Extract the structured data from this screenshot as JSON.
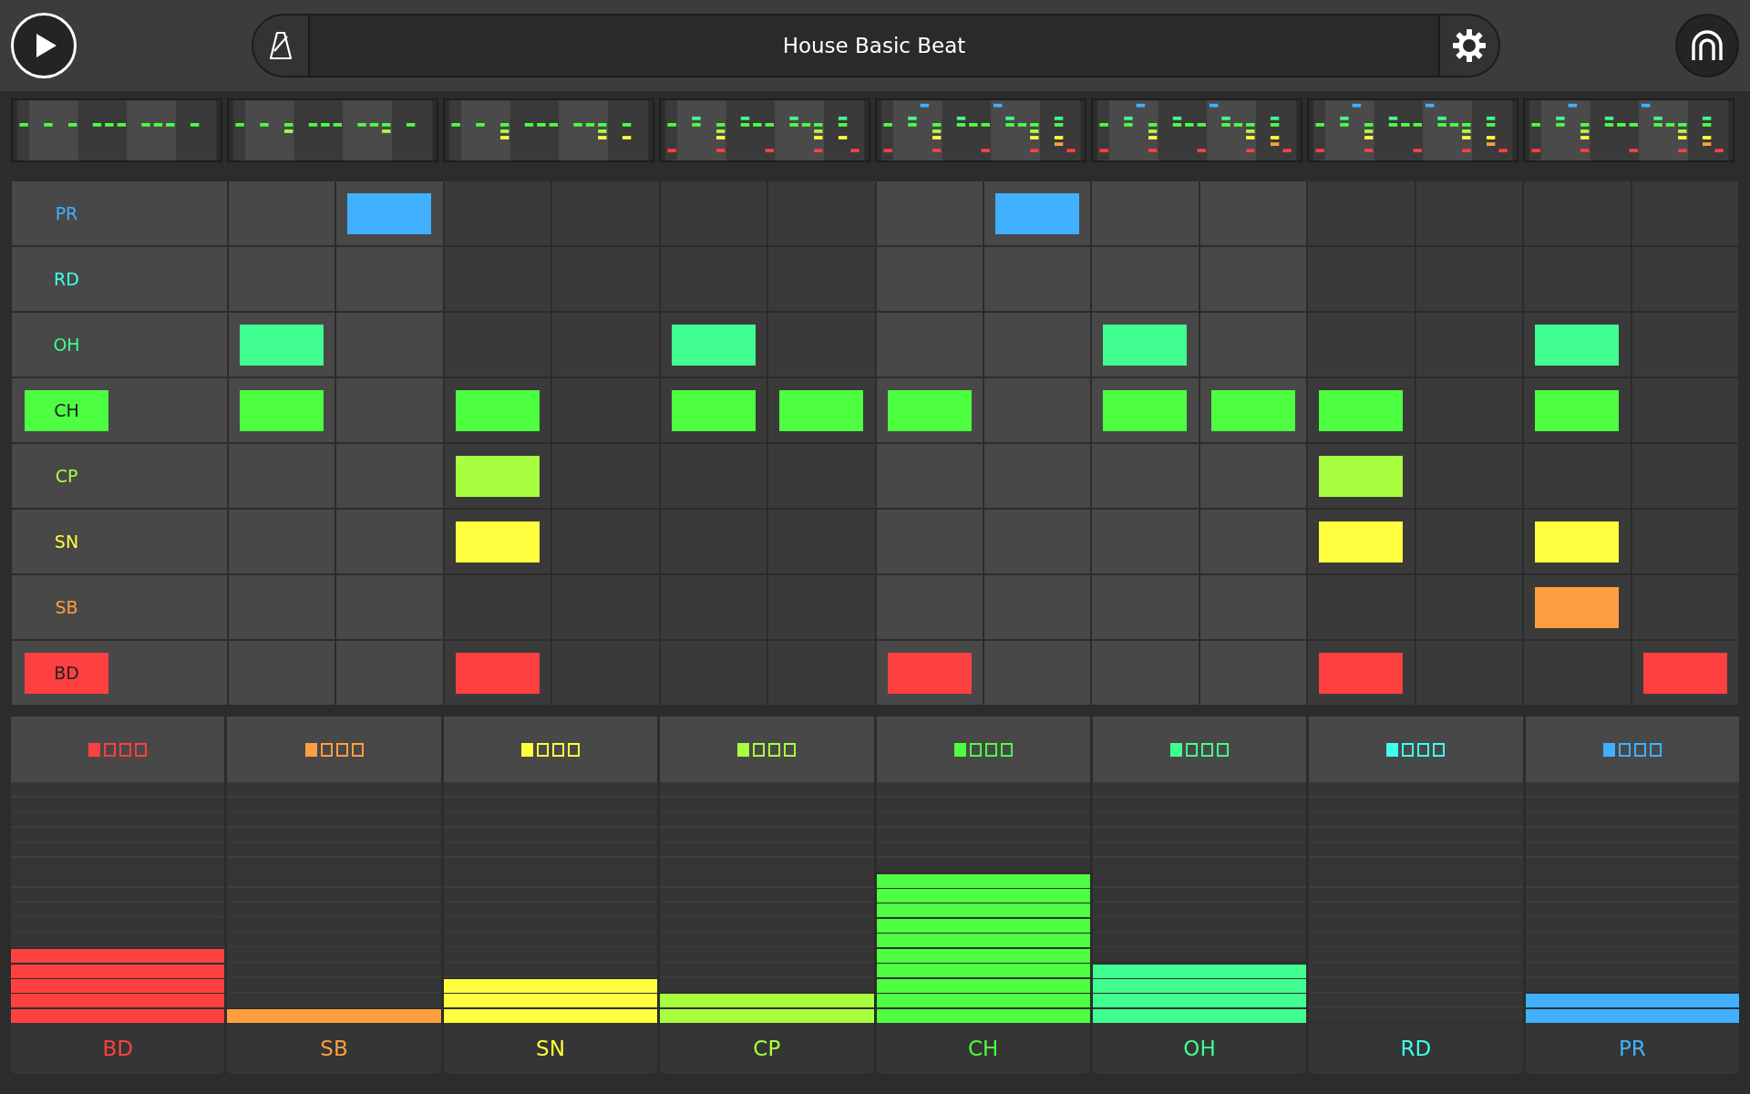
{
  "transport": {
    "title": "House Basic Beat"
  },
  "tracks": [
    {
      "name": "PR",
      "color": "#40b0ff",
      "label_lit": false,
      "steps": [
        false,
        true,
        false,
        false,
        false,
        false,
        false,
        true,
        false,
        false,
        false,
        false,
        false,
        false
      ]
    },
    {
      "name": "RD",
      "color": "#40ffee",
      "label_lit": false,
      "steps": [
        false,
        false,
        false,
        false,
        false,
        false,
        false,
        false,
        false,
        false,
        false,
        false,
        false,
        false
      ]
    },
    {
      "name": "OH",
      "color": "#40ff90",
      "label_lit": false,
      "steps": [
        true,
        false,
        false,
        false,
        true,
        false,
        false,
        false,
        true,
        false,
        false,
        false,
        true,
        false
      ]
    },
    {
      "name": "CH",
      "color": "#4dff40",
      "label_lit": true,
      "steps": [
        true,
        false,
        true,
        false,
        true,
        true,
        true,
        false,
        true,
        true,
        true,
        false,
        true,
        false
      ]
    },
    {
      "name": "CP",
      "color": "#a8ff40",
      "label_lit": false,
      "steps": [
        false,
        false,
        true,
        false,
        false,
        false,
        false,
        false,
        false,
        false,
        true,
        false,
        false,
        false
      ]
    },
    {
      "name": "SN",
      "color": "#ffff40",
      "label_lit": false,
      "steps": [
        false,
        false,
        true,
        false,
        false,
        false,
        false,
        false,
        false,
        false,
        true,
        false,
        true,
        false
      ]
    },
    {
      "name": "SB",
      "color": "#ff9e40",
      "label_lit": false,
      "steps": [
        false,
        false,
        false,
        false,
        false,
        false,
        false,
        false,
        false,
        false,
        false,
        false,
        true,
        false
      ]
    },
    {
      "name": "BD",
      "color": "#ff4040",
      "label_lit": true,
      "steps": [
        false,
        false,
        true,
        false,
        false,
        false,
        true,
        false,
        false,
        false,
        true,
        false,
        false,
        true
      ]
    }
  ],
  "mixer": [
    {
      "name": "BD",
      "color": "#ff4040",
      "slots": [
        {
          "selected": true
        },
        {
          "selected": false
        },
        {
          "selected": false
        },
        {
          "selected": false
        }
      ],
      "level": 0.3125
    },
    {
      "name": "SB",
      "color": "#ff9e40",
      "slots": [
        {
          "selected": true
        },
        {
          "selected": false
        },
        {
          "selected": false
        },
        {
          "selected": false
        }
      ],
      "level": 0.0625
    },
    {
      "name": "SN",
      "color": "#ffff40",
      "slots": [
        {
          "selected": true
        },
        {
          "selected": false
        },
        {
          "selected": false
        },
        {
          "selected": false
        }
      ],
      "level": 0.1875
    },
    {
      "name": "CP",
      "color": "#a8ff40",
      "slots": [
        {
          "selected": true
        },
        {
          "selected": false
        },
        {
          "selected": false
        },
        {
          "selected": false
        }
      ],
      "level": 0.125
    },
    {
      "name": "CH",
      "color": "#4dff40",
      "slots": [
        {
          "selected": true
        },
        {
          "selected": false
        },
        {
          "selected": false
        },
        {
          "selected": false
        }
      ],
      "level": 0.625
    },
    {
      "name": "OH",
      "color": "#40ff90",
      "slots": [
        {
          "selected": true
        },
        {
          "selected": false
        },
        {
          "selected": false
        },
        {
          "selected": false
        }
      ],
      "level": 0.25
    },
    {
      "name": "RD",
      "color": "#40ffee",
      "slots": [
        {
          "selected": true
        },
        {
          "selected": false
        },
        {
          "selected": false
        },
        {
          "selected": false
        }
      ],
      "level": 0
    },
    {
      "name": "PR",
      "color": "#40b0ff",
      "slots": [
        {
          "selected": true
        },
        {
          "selected": false
        },
        {
          "selected": false
        },
        {
          "selected": false
        }
      ],
      "level": 0.125
    }
  ]
}
